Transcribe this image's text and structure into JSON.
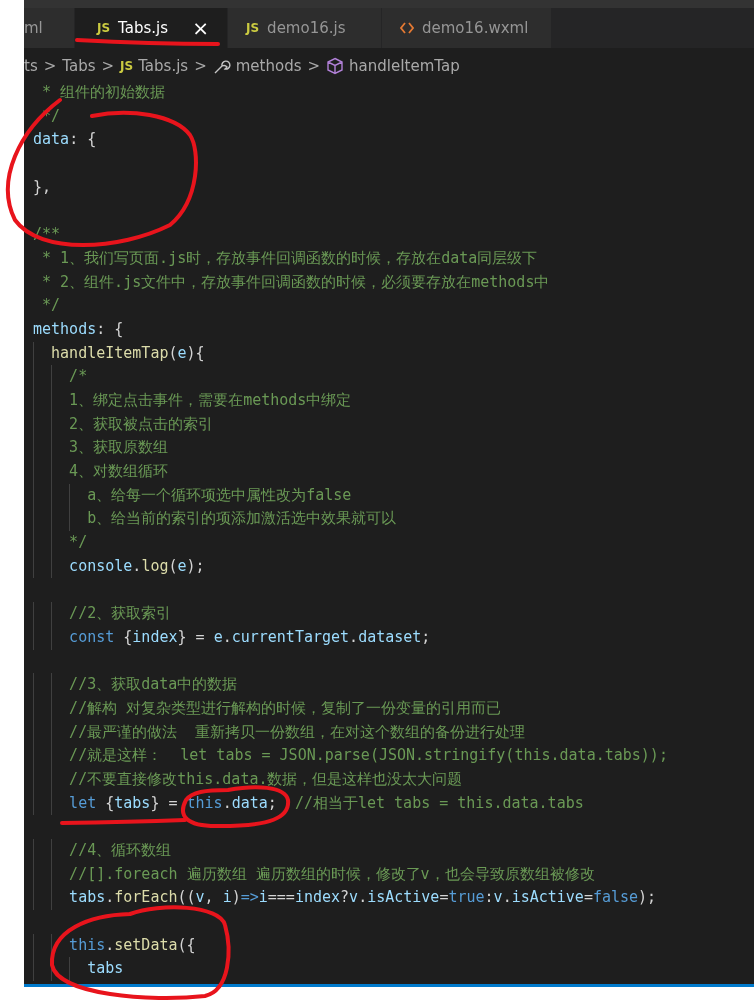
{
  "tabs": [
    {
      "label": "ml",
      "kind": "plain",
      "selected": false,
      "closable": false
    },
    {
      "label": "Tabs.js",
      "kind": "script",
      "badge": "JS",
      "selected": true,
      "closable": true,
      "close": "×"
    },
    {
      "label": "demo16.js",
      "kind": "script",
      "badge": "JS",
      "selected": false,
      "closable": false
    },
    {
      "label": "demo16.wxml",
      "kind": "markup",
      "selected": false,
      "closable": false
    }
  ],
  "breadcrumb": [
    {
      "label": "ts",
      "kind": "folder"
    },
    {
      "label": "Tabs",
      "kind": "folder"
    },
    {
      "label": "Tabs.js",
      "kind": "script",
      "badge": "JS"
    },
    {
      "label": "methods",
      "kind": "method-group"
    },
    {
      "label": "handleItemTap",
      "kind": "method"
    }
  ],
  "separator": ">",
  "code": [
    {
      "kind": "code",
      "tokens": [
        {
          "kind": "comment",
          "text": " * 组件的初始数据"
        }
      ]
    },
    {
      "kind": "code",
      "tokens": [
        {
          "kind": "comment",
          "text": " */"
        }
      ]
    },
    {
      "kind": "code",
      "tokens": [
        {
          "kind": "prop",
          "text": "data"
        },
        {
          "kind": "plain",
          "text": ": {"
        }
      ]
    },
    {
      "kind": "blank"
    },
    {
      "kind": "code",
      "tokens": [
        {
          "kind": "plain",
          "text": "},"
        }
      ]
    },
    {
      "kind": "blank"
    },
    {
      "kind": "code",
      "tokens": [
        {
          "kind": "comment",
          "text": "/**"
        }
      ]
    },
    {
      "kind": "code",
      "tokens": [
        {
          "kind": "comment",
          "text": " * 1、我们写页面.js时，存放事件回调函数的时候，存放在data同层级下"
        }
      ]
    },
    {
      "kind": "code",
      "tokens": [
        {
          "kind": "comment",
          "text": " * 2、组件.js文件中，存放事件回调函数的时候，必须要存放在methods中"
        }
      ]
    },
    {
      "kind": "code",
      "tokens": [
        {
          "kind": "comment",
          "text": " */"
        }
      ]
    },
    {
      "kind": "code",
      "tokens": [
        {
          "kind": "prop",
          "text": "methods"
        },
        {
          "kind": "plain",
          "text": ": {"
        }
      ]
    },
    {
      "kind": "code",
      "tokens": [
        {
          "kind": "func",
          "text": "  handleItemTap"
        },
        {
          "kind": "plain",
          "text": "("
        },
        {
          "kind": "prop",
          "text": "e"
        },
        {
          "kind": "plain",
          "text": "){"
        }
      ]
    },
    {
      "kind": "code",
      "tokens": [
        {
          "kind": "comment",
          "text": "    /*"
        }
      ]
    },
    {
      "kind": "code",
      "tokens": [
        {
          "kind": "comment",
          "text": "    1、绑定点击事件，需要在methods中绑定"
        }
      ]
    },
    {
      "kind": "code",
      "tokens": [
        {
          "kind": "comment",
          "text": "    2、获取被点击的索引"
        }
      ]
    },
    {
      "kind": "code",
      "tokens": [
        {
          "kind": "comment",
          "text": "    3、获取原数组"
        }
      ]
    },
    {
      "kind": "code",
      "tokens": [
        {
          "kind": "comment",
          "text": "    4、对数组循环"
        }
      ]
    },
    {
      "kind": "code",
      "tokens": [
        {
          "kind": "comment",
          "text": "      a、给每一个循环项选中属性改为false"
        }
      ]
    },
    {
      "kind": "code",
      "tokens": [
        {
          "kind": "comment",
          "text": "      b、给当前的索引的项添加激活选中效果就可以"
        }
      ]
    },
    {
      "kind": "code",
      "tokens": [
        {
          "kind": "comment",
          "text": "    */"
        }
      ]
    },
    {
      "kind": "code",
      "tokens": [
        {
          "kind": "prop",
          "text": "    console"
        },
        {
          "kind": "plain",
          "text": "."
        },
        {
          "kind": "func",
          "text": "log"
        },
        {
          "kind": "plain",
          "text": "("
        },
        {
          "kind": "prop",
          "text": "e"
        },
        {
          "kind": "plain",
          "text": ");"
        }
      ]
    },
    {
      "kind": "blank"
    },
    {
      "kind": "code",
      "tokens": [
        {
          "kind": "comment",
          "text": "    //2、获取索引"
        }
      ]
    },
    {
      "kind": "code",
      "tokens": [
        {
          "kind": "keyword",
          "text": "    const"
        },
        {
          "kind": "plain",
          "text": " {"
        },
        {
          "kind": "prop",
          "text": "index"
        },
        {
          "kind": "plain",
          "text": "} = "
        },
        {
          "kind": "prop",
          "text": "e"
        },
        {
          "kind": "plain",
          "text": "."
        },
        {
          "kind": "prop",
          "text": "currentTarget"
        },
        {
          "kind": "plain",
          "text": "."
        },
        {
          "kind": "prop",
          "text": "dataset"
        },
        {
          "kind": "plain",
          "text": ";"
        }
      ]
    },
    {
      "kind": "blank"
    },
    {
      "kind": "code",
      "tokens": [
        {
          "kind": "comment",
          "text": "    //3、获取data中的数据"
        }
      ]
    },
    {
      "kind": "code",
      "tokens": [
        {
          "kind": "comment",
          "text": "    //解构 对复杂类型进行解构的时候，复制了一份变量的引用而已"
        }
      ]
    },
    {
      "kind": "code",
      "tokens": [
        {
          "kind": "comment",
          "text": "    //最严谨的做法  重新拷贝一份数组，在对这个数组的备份进行处理"
        }
      ]
    },
    {
      "kind": "code",
      "tokens": [
        {
          "kind": "comment",
          "text": "    //就是这样：  let tabs = JSON.parse(JSON.stringify(this.data.tabs));"
        }
      ]
    },
    {
      "kind": "code",
      "tokens": [
        {
          "kind": "comment",
          "text": "    //不要直接修改this.data.数据，但是这样也没太大问题"
        }
      ]
    },
    {
      "kind": "code",
      "tokens": [
        {
          "kind": "keyword",
          "text": "    let"
        },
        {
          "kind": "plain",
          "text": " {"
        },
        {
          "kind": "prop",
          "text": "tabs"
        },
        {
          "kind": "plain",
          "text": "} = "
        },
        {
          "kind": "keyword",
          "text": "this"
        },
        {
          "kind": "plain",
          "text": "."
        },
        {
          "kind": "prop",
          "text": "data"
        },
        {
          "kind": "plain",
          "text": ";  "
        },
        {
          "kind": "comment",
          "text": "//相当于let tabs = this.data.tabs"
        }
      ]
    },
    {
      "kind": "blank"
    },
    {
      "kind": "code",
      "tokens": [
        {
          "kind": "comment",
          "text": "    //4、循环数组"
        }
      ]
    },
    {
      "kind": "code",
      "tokens": [
        {
          "kind": "comment",
          "text": "    //[].foreach 遍历数组 遍历数组的时候，修改了v，也会导致原数组被修改"
        }
      ]
    },
    {
      "kind": "code",
      "tokens": [
        {
          "kind": "prop",
          "text": "    tabs"
        },
        {
          "kind": "plain",
          "text": "."
        },
        {
          "kind": "func",
          "text": "forEach"
        },
        {
          "kind": "plain",
          "text": "(("
        },
        {
          "kind": "prop",
          "text": "v"
        },
        {
          "kind": "plain",
          "text": ", "
        },
        {
          "kind": "prop",
          "text": "i"
        },
        {
          "kind": "plain",
          "text": ")"
        },
        {
          "kind": "keyword",
          "text": "=>"
        },
        {
          "kind": "prop",
          "text": "i"
        },
        {
          "kind": "plain",
          "text": "==="
        },
        {
          "kind": "prop",
          "text": "index"
        },
        {
          "kind": "plain",
          "text": "?"
        },
        {
          "kind": "prop",
          "text": "v"
        },
        {
          "kind": "plain",
          "text": "."
        },
        {
          "kind": "prop",
          "text": "isActive"
        },
        {
          "kind": "plain",
          "text": "="
        },
        {
          "kind": "keyword",
          "text": "true"
        },
        {
          "kind": "plain",
          "text": ":"
        },
        {
          "kind": "prop",
          "text": "v"
        },
        {
          "kind": "plain",
          "text": "."
        },
        {
          "kind": "prop",
          "text": "isActive"
        },
        {
          "kind": "plain",
          "text": "="
        },
        {
          "kind": "keyword",
          "text": "false"
        },
        {
          "kind": "plain",
          "text": ");"
        }
      ]
    },
    {
      "kind": "blank"
    },
    {
      "kind": "code",
      "tokens": [
        {
          "kind": "keyword",
          "text": "    this"
        },
        {
          "kind": "plain",
          "text": "."
        },
        {
          "kind": "func",
          "text": "setData"
        },
        {
          "kind": "plain",
          "text": "({"
        }
      ]
    },
    {
      "kind": "code",
      "tokens": [
        {
          "kind": "prop",
          "text": "      tabs"
        }
      ]
    }
  ]
}
